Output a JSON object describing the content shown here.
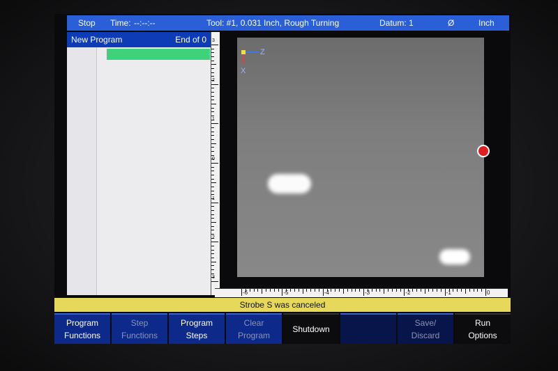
{
  "status": {
    "state": "Stop",
    "time_label": "Time:",
    "time_value": "--:--:--",
    "tool": "Tool: #1, 0.031 Inch, Rough Turning",
    "datum": "Datum: 1",
    "diameter_symbol": "Ø",
    "units": "Inch"
  },
  "program": {
    "title": "New Program",
    "position": "End of 0"
  },
  "plot": {
    "axis_z_label": "Z",
    "axis_x_label": "X",
    "vruler_labels": [
      "3",
      "2",
      "1",
      "0",
      "1",
      "2",
      "3"
    ],
    "hruler_labels": [
      "-6",
      "-5",
      "-4",
      "-3",
      "-2",
      "-1",
      "0"
    ]
  },
  "message": "Strobe S was canceled",
  "softkeys": [
    {
      "line1": "Program",
      "line2": "Functions",
      "state": "enabled"
    },
    {
      "line1": "Step",
      "line2": "Functions",
      "state": "disabled"
    },
    {
      "line1": "Program",
      "line2": "Steps",
      "state": "enabled"
    },
    {
      "line1": "Clear",
      "line2": "Program",
      "state": "disabled"
    },
    {
      "line1": "Shutdown",
      "line2": "",
      "state": "black"
    },
    {
      "line1": "",
      "line2": "",
      "state": "dark"
    },
    {
      "line1": "Save/",
      "line2": "Discard",
      "state": "disabled"
    },
    {
      "line1": "Run",
      "line2": "Options",
      "state": "enabled"
    }
  ]
}
